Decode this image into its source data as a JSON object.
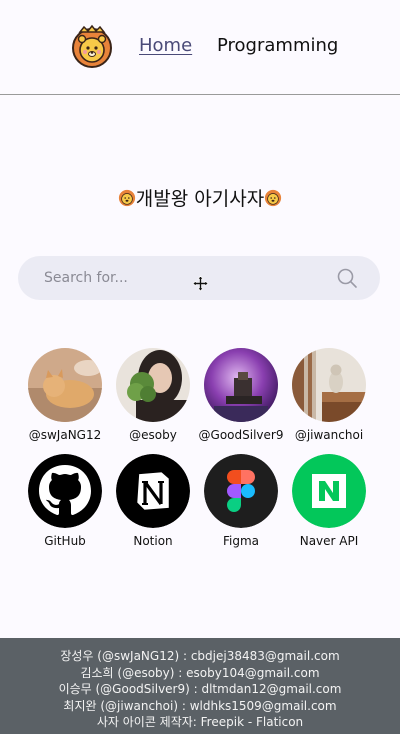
{
  "header": {
    "logo_icon": "lion-face-icon",
    "nav": [
      {
        "label": "Home",
        "active": true
      },
      {
        "label": "Programming",
        "active": false
      }
    ]
  },
  "title": {
    "text": "개발왕 아기사자",
    "icon": "lion-face-icon"
  },
  "search": {
    "placeholder": "Search for...",
    "icon": "search-icon"
  },
  "members": [
    {
      "handle": "@swJaNG12",
      "avatar": "cat-photo"
    },
    {
      "handle": "@esoby",
      "avatar": "person-photo"
    },
    {
      "handle": "@GoodSilver9",
      "avatar": "robot-photo"
    },
    {
      "handle": "@jiwanchoi",
      "avatar": "cat-on-stairs-photo"
    }
  ],
  "links": [
    {
      "label": "GitHub",
      "icon": "github-icon",
      "color": "#000000"
    },
    {
      "label": "Notion",
      "icon": "notion-icon",
      "color": "#000000"
    },
    {
      "label": "Figma",
      "icon": "figma-icon",
      "color": "#1e1e1e"
    },
    {
      "label": "Naver API",
      "icon": "naver-icon",
      "color": "#03c75a"
    }
  ],
  "footer": {
    "lines": [
      "장성우 (@swJaNG12) : cbdjej38483@gmail.com",
      "김소희 (@esoby) : esoby104@gmail.com",
      "이승무 (@GoodSilver9) : dltmdan12@gmail.com",
      "최지완 (@jiwanchoi) : wldhks1509@gmail.com",
      "사자 아이콘 제작자: Freepik - Flaticon"
    ]
  },
  "colors": {
    "background": "#fcfaff",
    "footer": "#5b6166",
    "search": "#ebebf4",
    "nav_active": "#4a4a78"
  }
}
